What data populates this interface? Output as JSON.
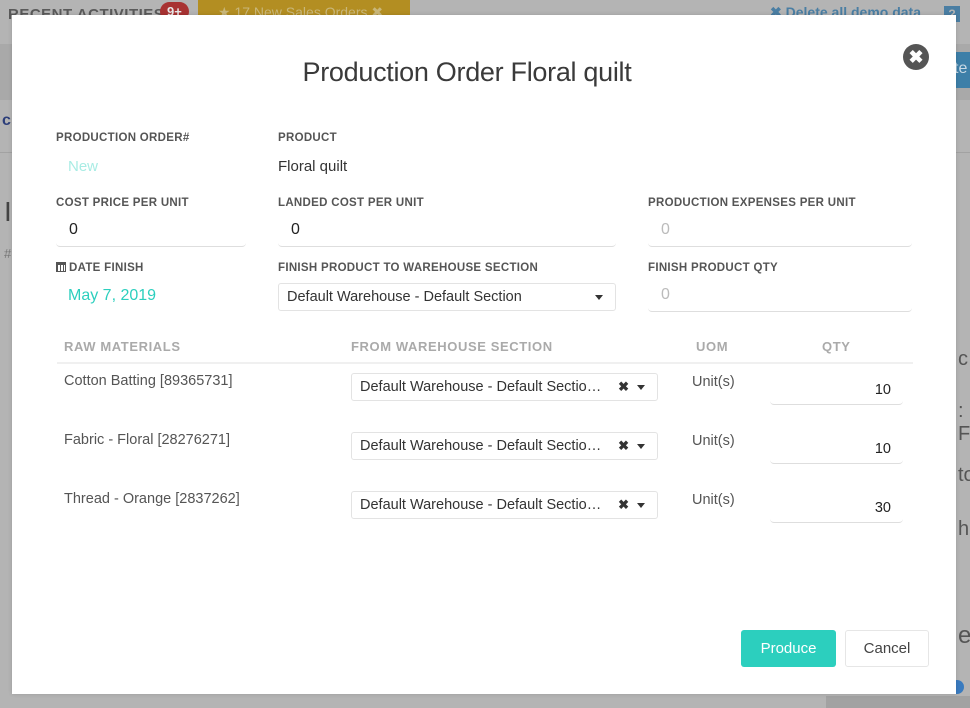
{
  "background": {
    "recent_activities": "RECENT ACTIVITIES",
    "recent_badge": "9+",
    "sales_orders_notice": "★ 17 New Sales Orders ✖",
    "delete_demo": "✖ Delete all demo data",
    "help_icon": "?",
    "side_button_text": "te",
    "right_snippets": [
      "c",
      ": F",
      "to",
      "h",
      "er"
    ],
    "left_snippets": [
      "c",
      "I",
      "#"
    ]
  },
  "modal": {
    "title": "Production Order Floral quilt",
    "close_icon": "✖",
    "production_order": {
      "label": "PRODUCTION ORDER#",
      "value": "New"
    },
    "product": {
      "label": "PRODUCT",
      "value": "Floral quilt"
    },
    "cost_price": {
      "label": "COST PRICE PER UNIT",
      "value": "0"
    },
    "landed_cost": {
      "label": "LANDED COST PER UNIT",
      "value": "0"
    },
    "production_expenses": {
      "label": "PRODUCTION EXPENSES PER UNIT",
      "placeholder": "0"
    },
    "date_finish": {
      "label": "DATE FINISH",
      "value": "May 7, 2019"
    },
    "finish_warehouse": {
      "label": "FINISH PRODUCT TO WAREHOUSE SECTION",
      "value": "Default Warehouse - Default Section"
    },
    "finish_qty": {
      "label": "FINISH PRODUCT QTY",
      "placeholder": "0"
    },
    "table": {
      "headers": [
        "RAW MATERIALS",
        "FROM WAREHOUSE SECTION",
        "UOM",
        "QTY"
      ],
      "rows": [
        {
          "material": "Cotton Batting [89365731]",
          "warehouse": "Default Warehouse - Default Sectio…",
          "uom": "Unit(s)",
          "qty": "10"
        },
        {
          "material": "Fabric - Floral [28276271]",
          "warehouse": "Default Warehouse - Default Sectio…",
          "uom": "Unit(s)",
          "qty": "10"
        },
        {
          "material": "Thread - Orange [2837262]",
          "warehouse": "Default Warehouse - Default Sectio…",
          "uom": "Unit(s)",
          "qty": "30"
        }
      ]
    },
    "buttons": {
      "produce": "Produce",
      "cancel": "Cancel"
    }
  },
  "colors": {
    "accent": "#2ccfbe",
    "overlay": "#b4b4b4",
    "close_bg": "#555555"
  }
}
